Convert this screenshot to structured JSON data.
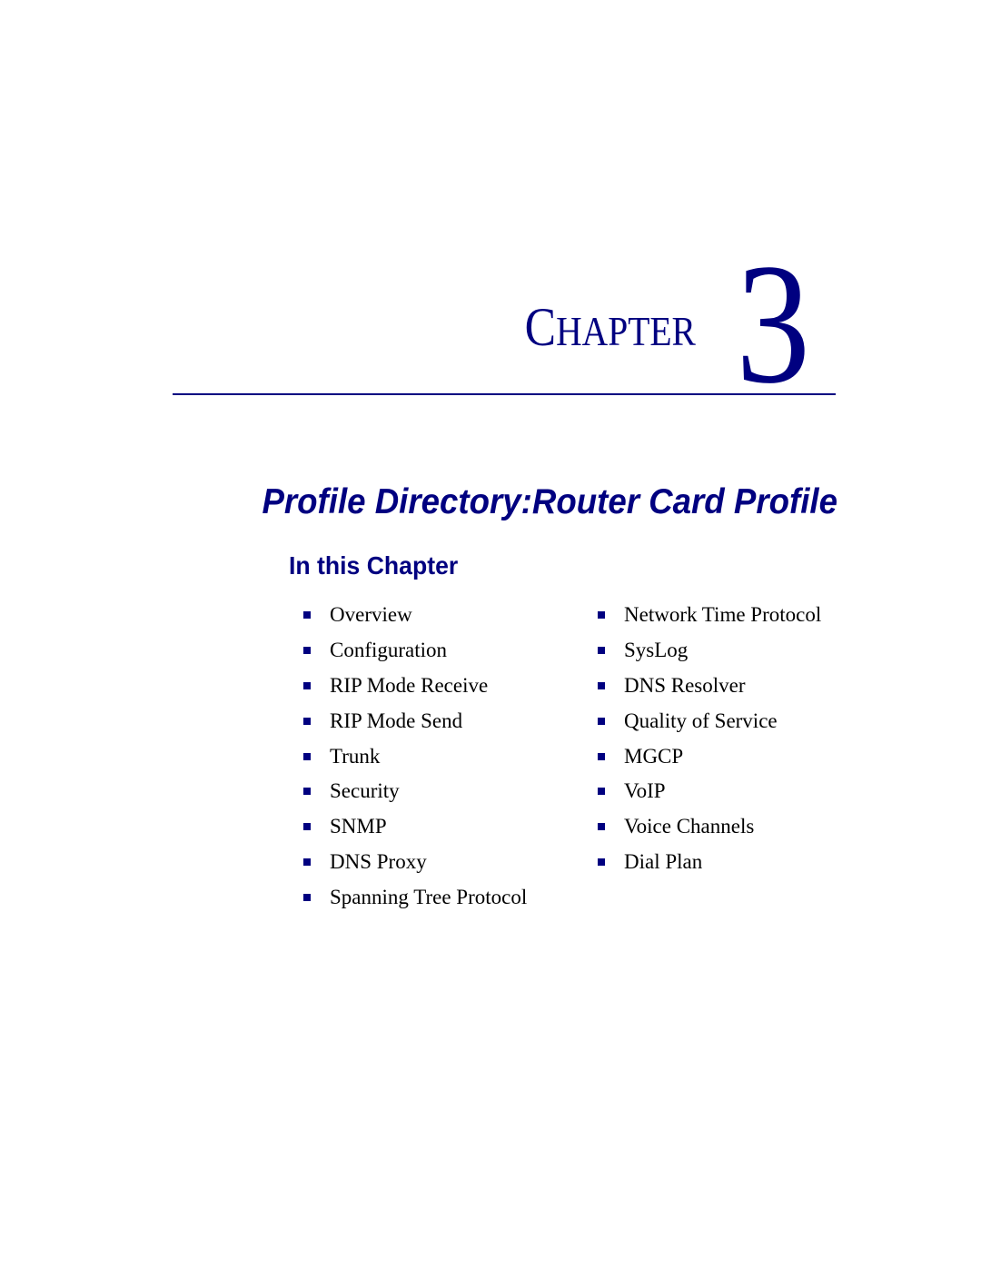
{
  "chapter": {
    "label_initial": "C",
    "label_rest": "HAPTER",
    "number": "3"
  },
  "title": "Profile Directory:Router Card Profile",
  "subtitle": "In this Chapter",
  "toc": {
    "left": [
      "Overview",
      "Configuration",
      "RIP Mode Receive",
      "RIP Mode Send",
      "Trunk",
      "Security",
      "SNMP",
      "DNS Proxy",
      "Spanning Tree Protocol"
    ],
    "right": [
      "Network Time Protocol",
      "SysLog",
      "DNS Resolver",
      "Quality of Service",
      "MGCP",
      "VoIP",
      "Voice Channels",
      "Dial Plan"
    ]
  },
  "colors": {
    "accent": "#000080",
    "text": "#000000"
  }
}
